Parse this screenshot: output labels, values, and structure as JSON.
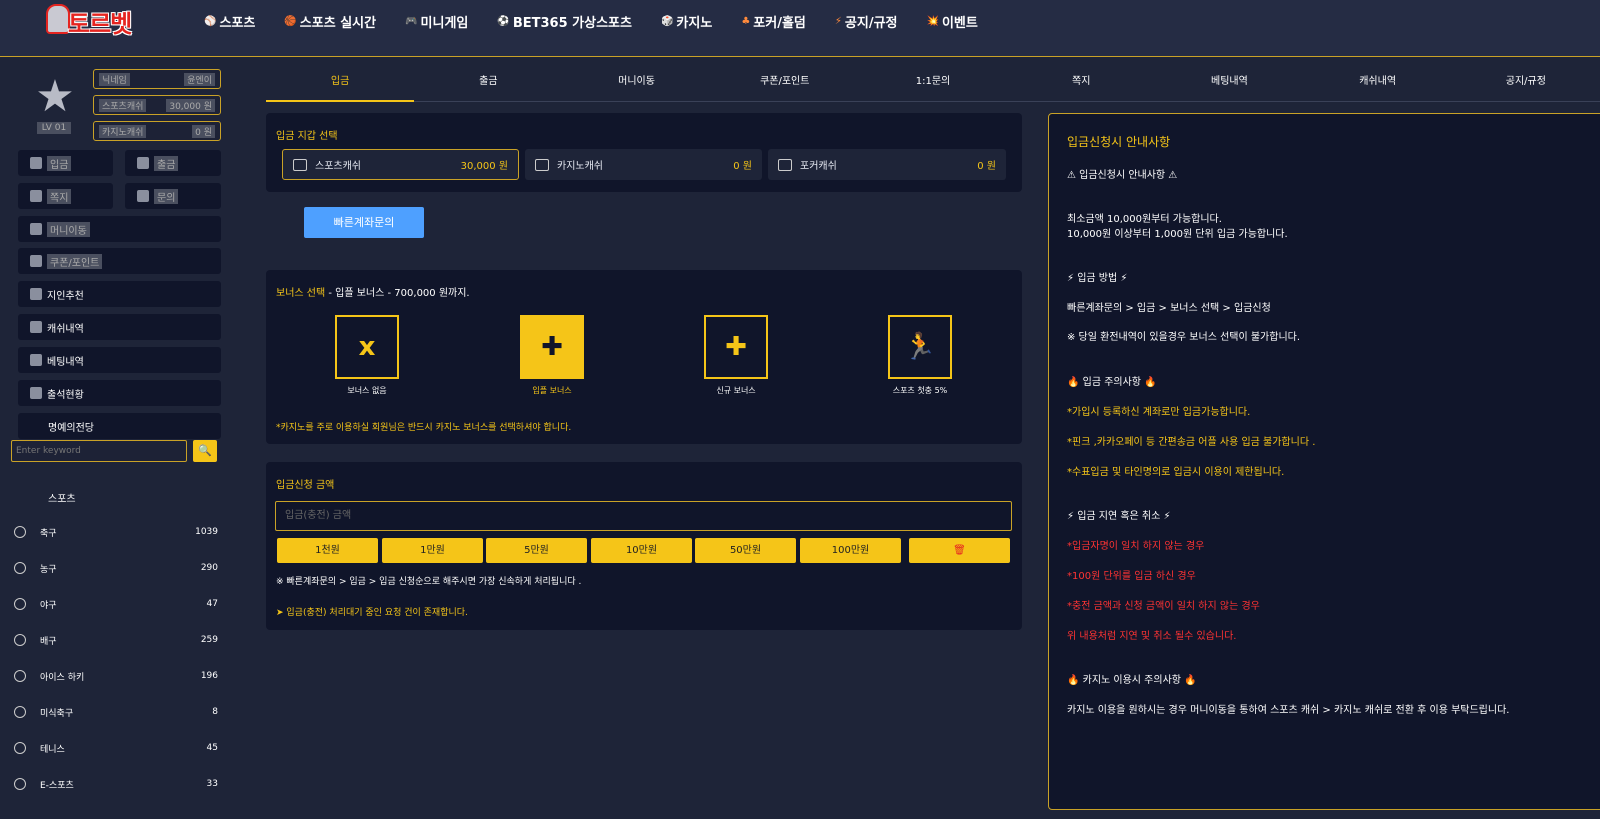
{
  "header": {
    "logo_text": "토르벳",
    "nav": [
      {
        "icon": "⚾",
        "label": "스포츠"
      },
      {
        "icon": "🏀",
        "label": "스포츠 실시간"
      },
      {
        "icon": "🎮",
        "label": "미니게임"
      },
      {
        "icon": "⚽",
        "label": "BET365 가상스포츠"
      },
      {
        "icon": "🎲",
        "label": "카지노"
      },
      {
        "icon": "♣",
        "label": "포커/홀덤"
      },
      {
        "icon": "⚡",
        "label": "공지/규정"
      },
      {
        "icon": "💥",
        "label": "이벤트"
      }
    ]
  },
  "profile": {
    "level": "LV 01",
    "nickname_label": "닉네임",
    "nickname_value": "윤엔이",
    "sports_cash_label": "스포츠캐쉬",
    "sports_cash_value": "30,000 원",
    "casino_cash_label": "카지노캐쉬",
    "casino_cash_value": "0 원"
  },
  "side_buttons": {
    "deposit": "입금",
    "withdraw": "출금",
    "message": "쪽지",
    "inquiry": "문의",
    "money_move": "머니이동",
    "coupon": "쿠폰/포인트",
    "referral": "지인추천",
    "cash_history": "캐쉬내역",
    "bet_history": "베팅내역",
    "attendance": "출석현황",
    "hall_of_fame": "명예의전당"
  },
  "search": {
    "placeholder": "Enter keyword"
  },
  "sports": {
    "title": "스포츠",
    "items": [
      {
        "name": "축구",
        "count": "1039"
      },
      {
        "name": "농구",
        "count": "290"
      },
      {
        "name": "야구",
        "count": "47"
      },
      {
        "name": "배구",
        "count": "259"
      },
      {
        "name": "아이스 하키",
        "count": "196"
      },
      {
        "name": "미식축구",
        "count": "8"
      },
      {
        "name": "테니스",
        "count": "45"
      },
      {
        "name": "E-스포츠",
        "count": "33"
      }
    ]
  },
  "tabs": [
    "입금",
    "출금",
    "머니이동",
    "쿠폰/포인트",
    "1:1문의",
    "쪽지",
    "베팅내역",
    "캐쉬내역",
    "공지/규정"
  ],
  "wallet": {
    "title": "입금 지갑 선택",
    "items": [
      {
        "name": "스포츠캐쉬",
        "amount": "30,000 원"
      },
      {
        "name": "카지노캐쉬",
        "amount": "0 원"
      },
      {
        "name": "포커캐쉬",
        "amount": "0 원"
      }
    ]
  },
  "quick_account": "빠른계좌문의",
  "bonus": {
    "title_highlight": "보너스 선택",
    "title_rest": " - 입플 보너스 - 700,000 원까지.",
    "options": [
      {
        "icon": "x",
        "label": "보너스 없음"
      },
      {
        "icon": "✚",
        "label": "입플 보너스"
      },
      {
        "icon": "✚",
        "label": "신규 보너스"
      },
      {
        "icon": "🏃",
        "label": "스포츠 첫충 5%"
      }
    ],
    "note": "*카지노를 주로 이용하실 회원님은 반드시 카지노 보너스를 선택하셔야 합니다."
  },
  "amount": {
    "title": "입금신청 금액",
    "placeholder": "입금(충전) 금액",
    "buttons": [
      "1천원",
      "1만원",
      "5만원",
      "10만원",
      "50만원",
      "100만원"
    ],
    "clear_icon": "🗑",
    "note1": "※ 빠른계좌문의 > 입금 > 입금 신청순으로 해주시면 가장 신속하게 처리됩니다 .",
    "note2": "입금(충전) 처리대기 중인 요청 건이 존재합니다."
  },
  "guide": {
    "title": "입금신청시 안내사항",
    "lines": [
      {
        "t": "⚠ 입금신청시 안내사항 ⚠",
        "c": ""
      },
      {
        "t": "최소금액 10,000원부터 가능합니다.",
        "c": ""
      },
      {
        "t": "10,000원 이상부터 1,000원 단위 입금 가능합니다.",
        "c": ""
      },
      {
        "t": "⚡ 입금 방법 ⚡",
        "c": ""
      },
      {
        "t": "빠른계좌문의 > 입금 > 보너스 선택 > 입금신청",
        "c": ""
      },
      {
        "t": "※ 당일 환전내역이 있을경우 보너스 선택이 불가합니다.",
        "c": ""
      },
      {
        "t": "🔥 입금 주의사항 🔥",
        "c": ""
      },
      {
        "t": "*가입시 등록하신 계좌로만 입금가능합니다.",
        "c": "y"
      },
      {
        "t": "*핀크 ,카카오페이 등 간편송금 어플 사용 입금 불가합니다 .",
        "c": "y"
      },
      {
        "t": "*수표입금 및 타인명의로 입금시 이용이 제한됩니다.",
        "c": "y"
      },
      {
        "t": "⚡ 입금 지연 혹은 취소 ⚡",
        "c": ""
      },
      {
        "t": "*입금자명이 일치 하지 않는 경우",
        "c": "r"
      },
      {
        "t": "*100원 단위를 입금 하신 경우",
        "c": "r"
      },
      {
        "t": "*충전 금액과 신청 금액이 일치 하지 않는 경우",
        "c": "r"
      },
      {
        "t": "위 내용처럼 지연 및 취소 될수 있습니다.",
        "c": "r"
      },
      {
        "t": "🔥 카지노 이용시 주의사항 🔥",
        "c": ""
      },
      {
        "t": "카지노 이용을 원하시는 경우 머니이동을 통하여 스포츠 캐쉬 > 카지노 캐쉬로 전환 후 이용 부탁드립니다.",
        "c": ""
      }
    ]
  },
  "colors": {
    "accent": "#f5c518",
    "bg": "#1e2438",
    "panel": "#10152a",
    "link": "#4ea0ff",
    "warn": "#ff3333"
  }
}
